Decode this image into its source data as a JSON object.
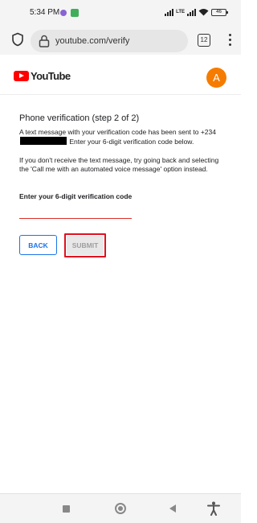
{
  "status_bar": {
    "time": "5:34 PM",
    "battery": "46",
    "network_label": "LTE"
  },
  "browser": {
    "url": "youtube.com/verify",
    "tab_count": "12"
  },
  "header": {
    "logo_text": "YouTube",
    "avatar_initial": "A"
  },
  "verification": {
    "heading": "Phone verification (step 2 of 2)",
    "message_prefix": "A text message with your verification code has been sent to +234",
    "message_suffix": " Enter your 6-digit verification code below.",
    "help_text": "If you don't receive the text message, try going back and selecting the 'Call me with an automated voice message' option instead.",
    "code_label": "Enter your 6-digit verification code",
    "code_value": "",
    "back_label": "BACK",
    "submit_label": "SUBMIT"
  },
  "colors": {
    "brand_red": "#ff0000",
    "link_blue": "#1a73e8",
    "input_underline": "#d93025",
    "avatar_bg": "#f57c00",
    "highlight_box": "#e0101f"
  },
  "icons": {
    "shield": "shield-icon",
    "lock": "lock-icon",
    "menu": "more-vert-icon",
    "recents": "recents-square-icon",
    "home": "home-circle-icon",
    "back": "back-triangle-icon",
    "accessibility": "accessibility-icon"
  }
}
